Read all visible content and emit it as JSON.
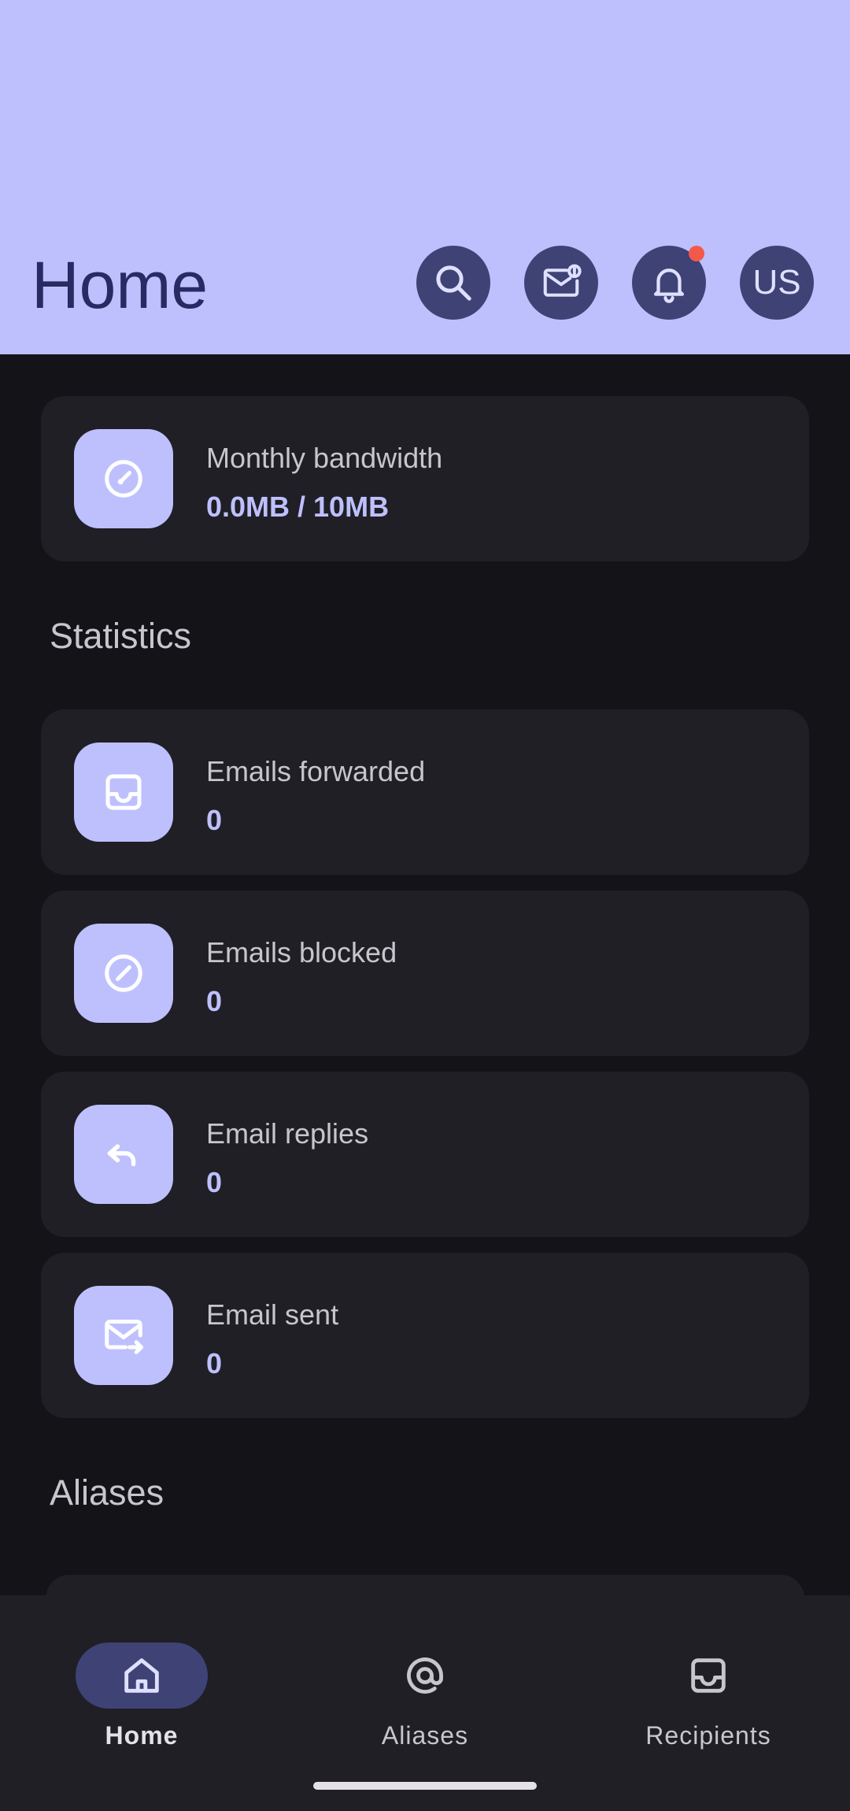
{
  "header": {
    "title": "Home",
    "avatar_initials": "US",
    "icons": {
      "search": "search-icon",
      "mail_alert": "mail-alert-icon",
      "bell": "bell-icon"
    },
    "colors": {
      "background": "#bec0fe",
      "button": "#3e4275",
      "title": "#272a63",
      "notification_dot": "#f2594b"
    }
  },
  "bandwidth": {
    "label": "Monthly bandwidth",
    "value": "0.0MB / 10MB",
    "icon": "gauge-icon"
  },
  "statistics": {
    "title": "Statistics",
    "items": [
      {
        "label": "Emails forwarded",
        "value": "0",
        "icon": "inbox-icon"
      },
      {
        "label": "Emails blocked",
        "value": "0",
        "icon": "blocked-icon"
      },
      {
        "label": "Email replies",
        "value": "0",
        "icon": "reply-icon"
      },
      {
        "label": "Email sent",
        "value": "0",
        "icon": "mail-send-icon"
      }
    ]
  },
  "aliases": {
    "title": "Aliases"
  },
  "bottom_nav": {
    "items": [
      {
        "label": "Home",
        "icon": "home-icon",
        "active": true
      },
      {
        "label": "Aliases",
        "icon": "at-icon",
        "active": false
      },
      {
        "label": "Recipients",
        "icon": "inbox-icon",
        "active": false
      }
    ]
  },
  "theme": {
    "background": "#141318",
    "card": "#1f1f25",
    "accent": "#bec0fe",
    "text_muted": "#c7c6cd"
  }
}
